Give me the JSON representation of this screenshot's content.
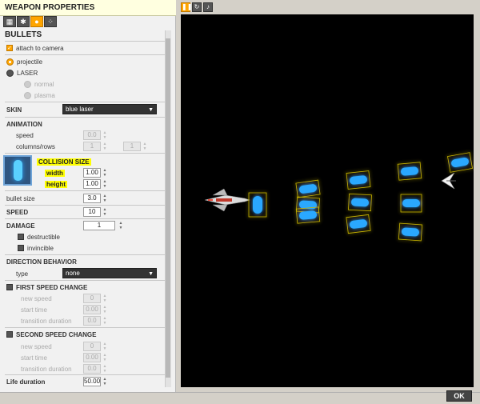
{
  "panel": {
    "title": "WEAPON PROPERTIES",
    "section": "BULLETS",
    "tab_icons": [
      "grid-icon",
      "gear-icon",
      "bullet-icon",
      "particles-icon"
    ]
  },
  "attach_to_camera": {
    "label": "attach to camera",
    "checked": true
  },
  "bullet_type": {
    "projectile": "projectile",
    "laser": "LASER",
    "normal": "normal",
    "plasma": "plasma"
  },
  "skin": {
    "label": "SKIN",
    "value": "blue laser"
  },
  "animation": {
    "label": "ANIMATION",
    "speed_label": "speed",
    "speed_value": "0.0",
    "columns_rows_label": "columns/rows",
    "columns_value": "1",
    "rows_value": "1"
  },
  "collision": {
    "title": "COLLISION SIZE",
    "width_label": "width",
    "width_value": "1.00",
    "height_label": "height",
    "height_value": "1.00"
  },
  "bullet_size": {
    "label": "bullet size",
    "value": "3.0"
  },
  "speed": {
    "label": "SPEED",
    "value": "10"
  },
  "damage": {
    "label": "DAMAGE",
    "value": "1",
    "destructible": "destructible",
    "invincible": "invincible"
  },
  "direction": {
    "label": "DIRECTION BEHAVIOR",
    "type_label": "type",
    "type_value": "none"
  },
  "first_change": {
    "label": "FIRST SPEED CHANGE",
    "new_speed_label": "new speed",
    "new_speed": "0",
    "start_time_label": "start time",
    "start_time": "0.00",
    "transition_label": "transition duration",
    "transition": "0.0"
  },
  "second_change": {
    "label": "SECOND SPEED CHANGE",
    "new_speed_label": "new speed",
    "new_speed": "0",
    "start_time_label": "start time",
    "start_time": "0.00",
    "transition_label": "transition duration",
    "transition": "0.0"
  },
  "life": {
    "label": "Life duration",
    "value": "50.00"
  },
  "preview_toolbar": [
    "pause-icon",
    "refresh-icon",
    "sound-icon"
  ],
  "ok_label": "OK",
  "colors": {
    "accent": "#ffa500",
    "highlight": "#ffff00",
    "bullet": "#2aa8ff",
    "canvas": "#000000"
  }
}
